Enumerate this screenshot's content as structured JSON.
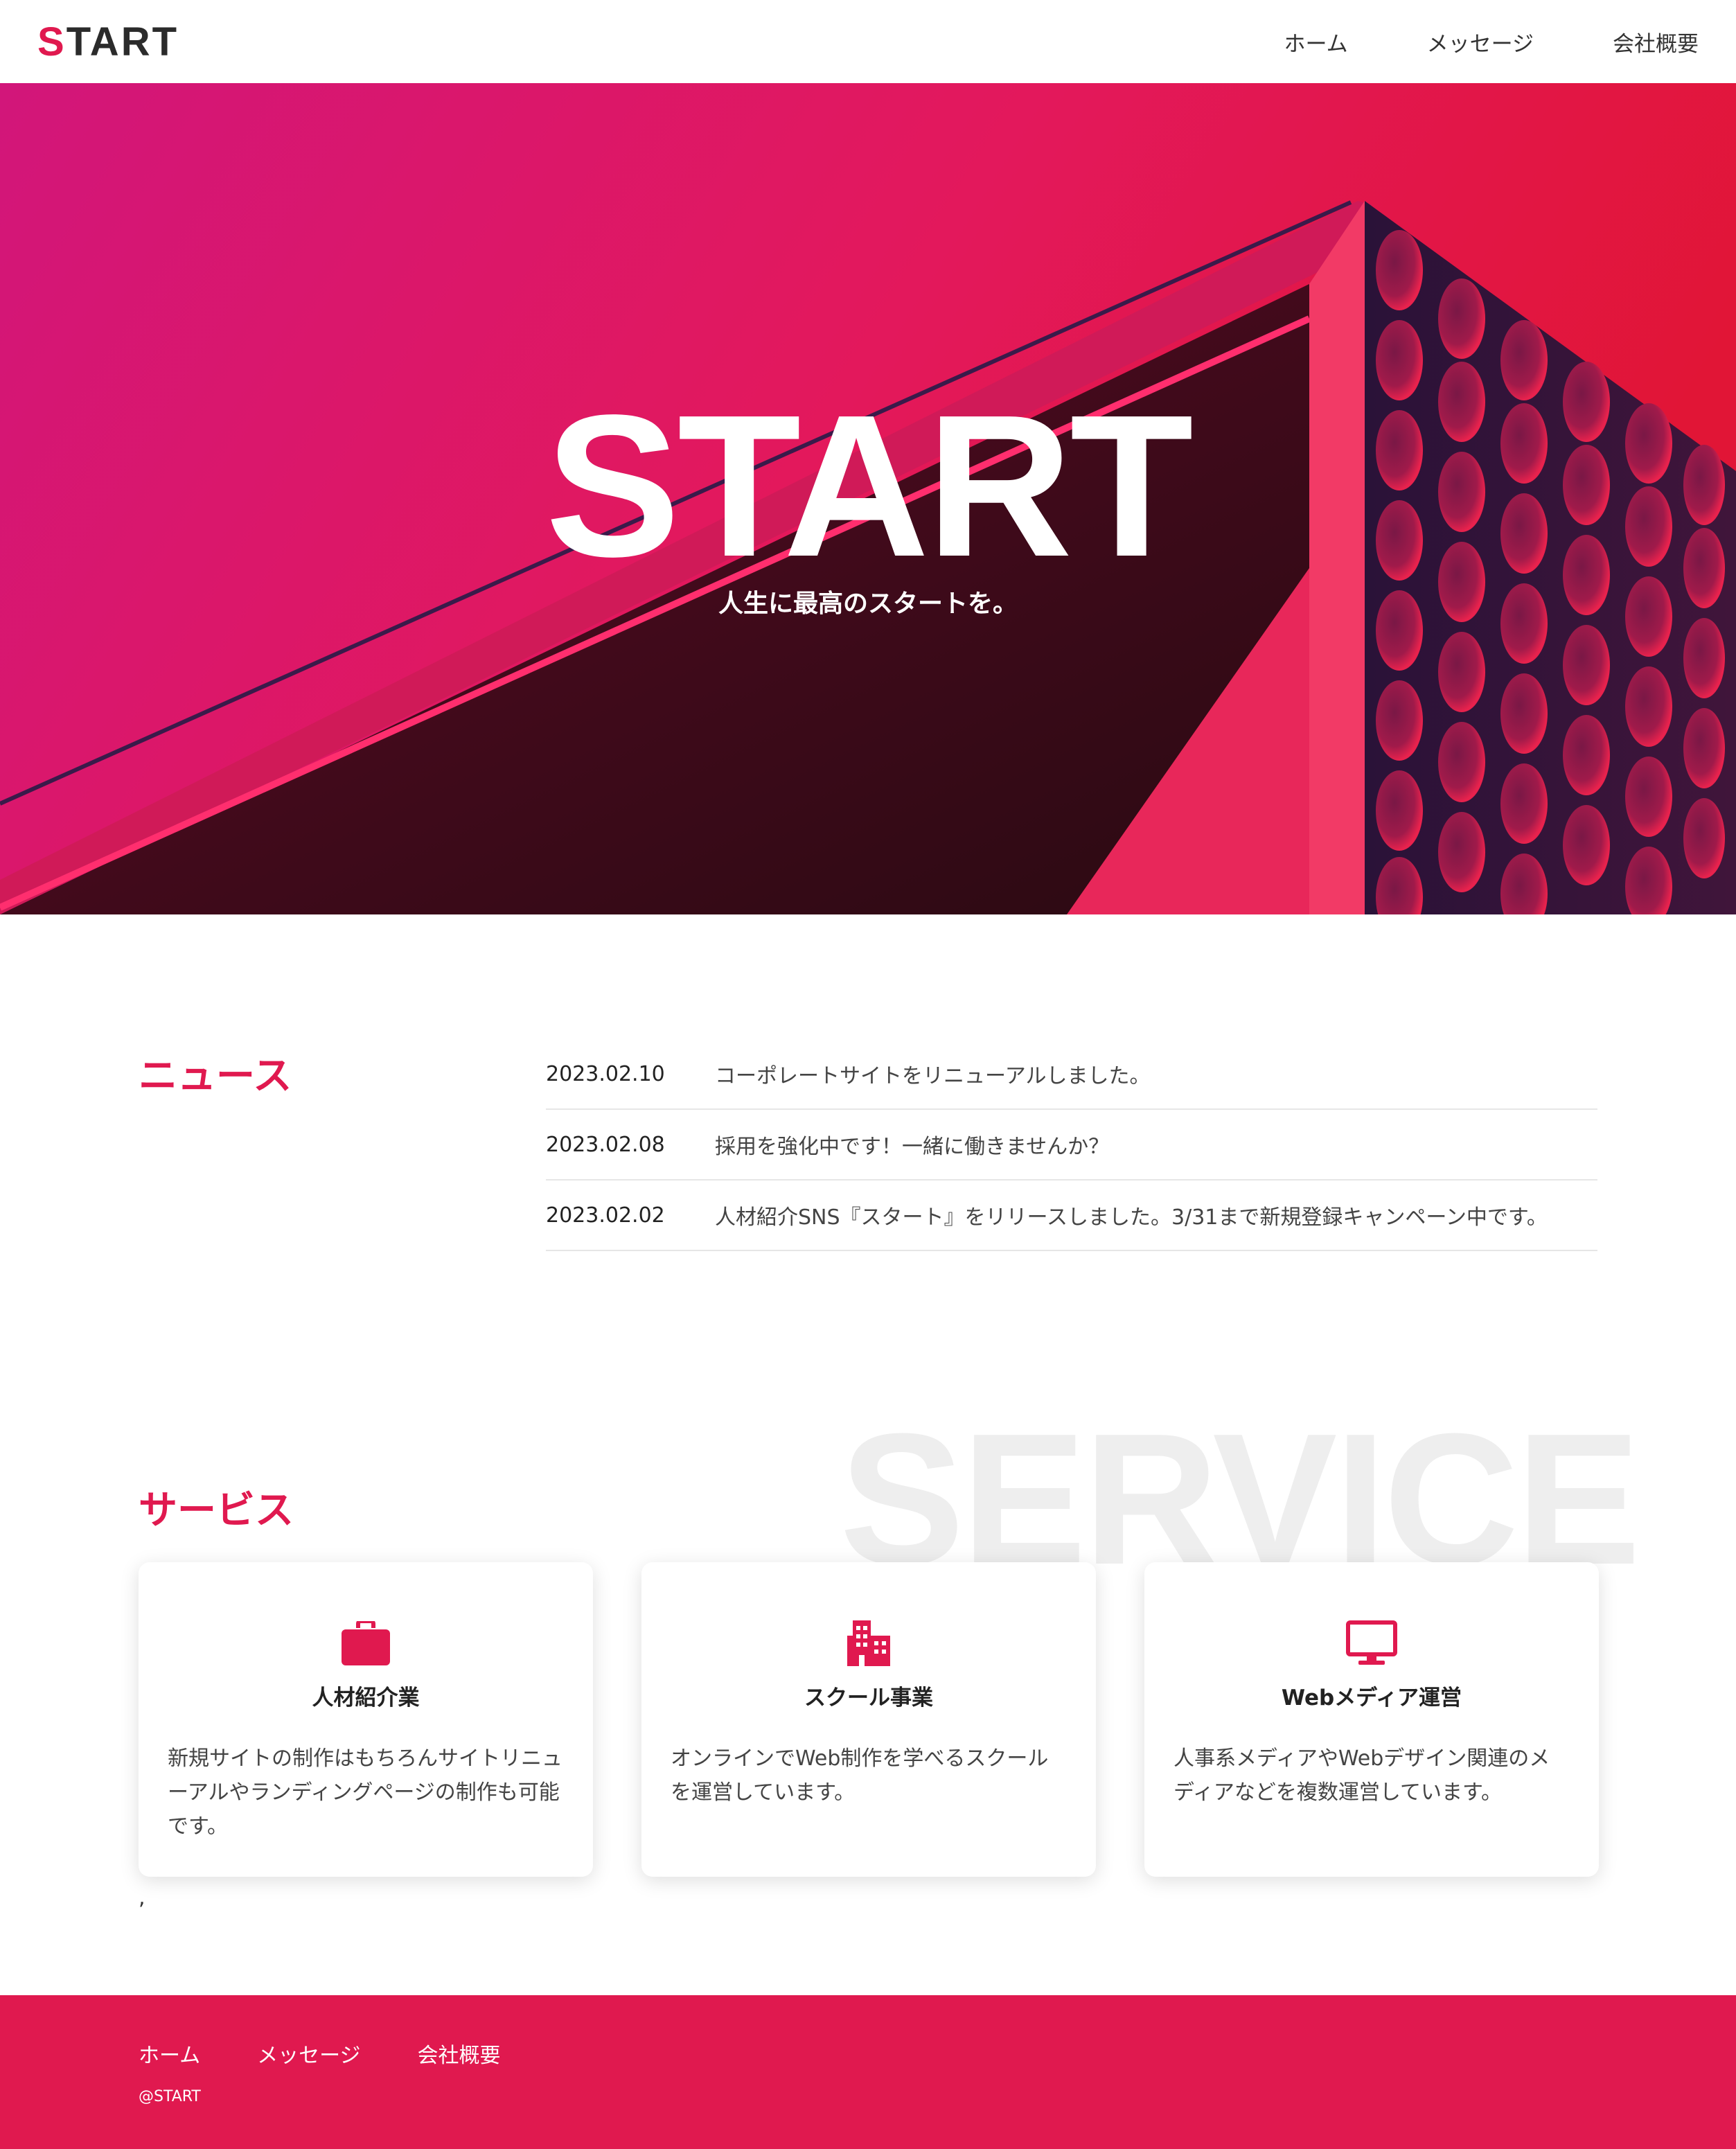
{
  "header": {
    "logo_first": "S",
    "logo_rest": "TART",
    "nav": [
      "ホーム",
      "メッセージ",
      "会社概要"
    ]
  },
  "hero": {
    "title": "START",
    "subtitle": "人生に最高のスタートを。"
  },
  "news": {
    "heading": "ニュース",
    "items": [
      {
        "date": "2023.02.10",
        "text": "コーポレートサイトをリニューアルしました。"
      },
      {
        "date": "2023.02.08",
        "text": "採用を強化中です！一緒に働きませんか？"
      },
      {
        "date": "2023.02.02",
        "text": "人材紹介SNS『スタート』をリリースしました。3/31まで新規登録キャンペーン中です。"
      }
    ]
  },
  "service": {
    "background_text": "SERVICE",
    "heading": "サービス",
    "cards": [
      {
        "icon": "briefcase-icon",
        "title": "人材紹介業",
        "desc": "新規サイトの制作はもちろんサイトリニューアルやランディングページの制作も可能です。"
      },
      {
        "icon": "building-icon",
        "title": "スクール事業",
        "desc": "オンラインでWeb制作を学べるスクールを運営しています。"
      },
      {
        "icon": "monitor-icon",
        "title": "Webメディア運営",
        "desc": "人事系メディアやWebデザイン関連のメディアなどを複数運営しています。"
      }
    ],
    "stray_mark": ","
  },
  "footer": {
    "nav": [
      "ホーム",
      "メッセージ",
      "会社概要"
    ],
    "copyright": "@START"
  },
  "colors": {
    "accent": "#e0194f",
    "hero_gradient_left": "#d4157a",
    "hero_gradient_right": "#e01535",
    "dark": "#2b2b2b"
  }
}
